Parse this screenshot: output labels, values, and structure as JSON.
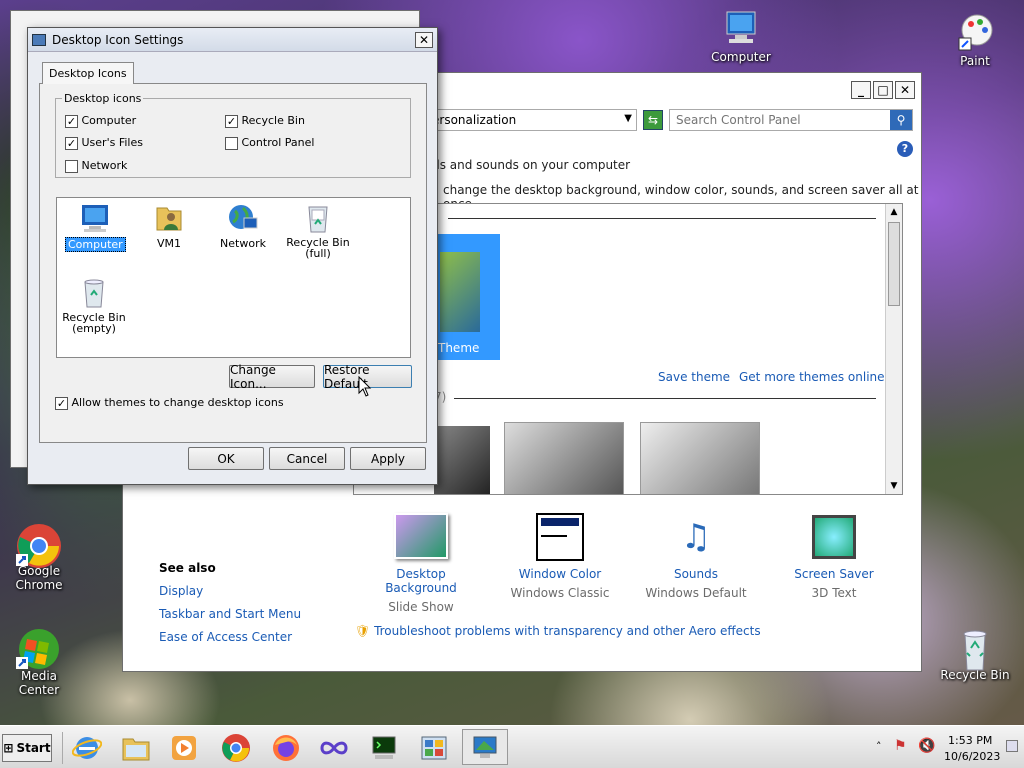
{
  "desktop": {
    "icons": [
      {
        "label": "Computer"
      },
      {
        "label": "Paint"
      },
      {
        "label": "Google Chrome"
      },
      {
        "label": "Media Center"
      },
      {
        "label": "Recycle Bin"
      }
    ]
  },
  "control_panel": {
    "address_text": "ersonalization",
    "search_placeholder": "Search Control Panel",
    "heading": "als and sounds on your computer",
    "subheading": "change the desktop background, window color, sounds, and screen saver all at once.",
    "group1_label": ")",
    "selected_theme_label": "Theme",
    "save_theme": "Save theme",
    "get_more_themes": "Get more themes online",
    "group2_label": "7)",
    "see_also_title": "See also",
    "see_also": [
      "Display",
      "Taskbar and Start Menu",
      "Ease of Access Center"
    ],
    "items": [
      {
        "title": "Desktop Background",
        "sub": "Slide Show"
      },
      {
        "title": "Window Color",
        "sub": "Windows Classic"
      },
      {
        "title": "Sounds",
        "sub": "Windows Default"
      },
      {
        "title": "Screen Saver",
        "sub": "3D Text"
      }
    ],
    "troubleshoot": "Troubleshoot problems with transparency and other Aero effects"
  },
  "dialog": {
    "title": "Desktop Icon Settings",
    "tab": "Desktop Icons",
    "group_label": "Desktop icons",
    "checkboxes": [
      {
        "label": "Computer",
        "checked": true
      },
      {
        "label": "Recycle Bin",
        "checked": true
      },
      {
        "label": "User's Files",
        "checked": true
      },
      {
        "label": "Control Panel",
        "checked": false
      },
      {
        "label": "Network",
        "checked": false
      }
    ],
    "icons": [
      {
        "label": "Computer"
      },
      {
        "label": "VM1"
      },
      {
        "label": "Network"
      },
      {
        "label": "Recycle Bin\n(full)"
      },
      {
        "label": "Recycle Bin\n(empty)"
      }
    ],
    "change_icon": "Change Icon...",
    "restore_default": "Restore Default",
    "allow_themes": "Allow themes to change desktop icons",
    "ok": "OK",
    "cancel": "Cancel",
    "apply": "Apply"
  },
  "taskbar": {
    "start": "Start",
    "time": "1:53 PM",
    "date": "10/6/2023"
  }
}
